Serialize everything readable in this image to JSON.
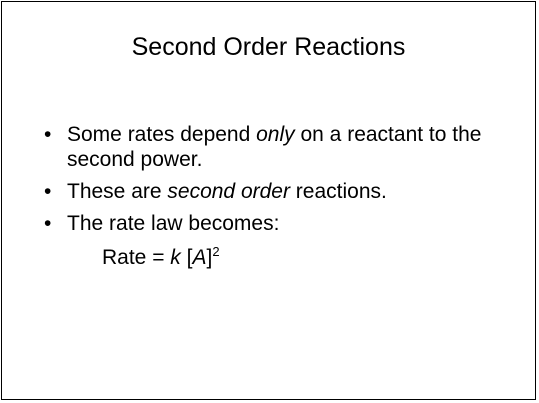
{
  "slide": {
    "title": "Second Order Reactions",
    "bullet_marker": "•",
    "bullets": [
      {
        "before": "Some rates depend ",
        "emphasis": "only",
        "after": " on a reactant to the second power."
      },
      {
        "before": "These are ",
        "emphasis": "second order",
        "after": " reactions."
      },
      {
        "text": "The rate law becomes:"
      }
    ],
    "formula": {
      "lhs": "Rate = ",
      "constant": "k",
      "open_bracket": " [",
      "species": "A",
      "close_bracket": "]",
      "exponent": "2"
    }
  }
}
